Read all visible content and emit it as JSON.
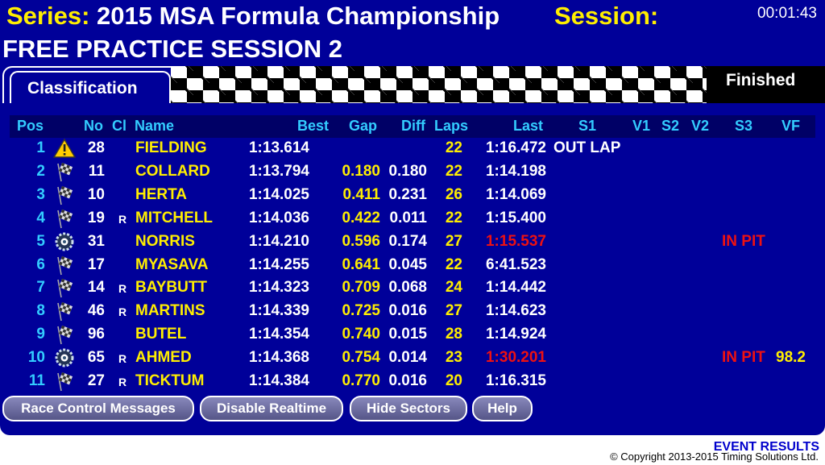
{
  "header": {
    "series_label": "Series:",
    "series_name": "2015 MSA Formula Championship",
    "session_label": "Session:",
    "session_name": "FREE PRACTICE SESSION 2",
    "clock": "00:01:43"
  },
  "tabs": {
    "classification": "Classification"
  },
  "status": "Finished",
  "columns": {
    "pos": "Pos",
    "no": "No",
    "cl": "Cl",
    "name": "Name",
    "best": "Best",
    "gap": "Gap",
    "diff": "Diff",
    "laps": "Laps",
    "last": "Last",
    "s1": "S1",
    "v1": "V1",
    "s2": "S2",
    "v2": "V2",
    "s3": "S3",
    "vf": "VF"
  },
  "rows": [
    {
      "pos": "1",
      "icon": "warning-icon",
      "no": "28",
      "cl": "",
      "name": "FIELDING",
      "best": "1:13.614",
      "gap": "",
      "diff": "",
      "laps": "22",
      "last": "1:16.472",
      "last_red": false,
      "s1": "OUT LAP",
      "s3": "",
      "vf": ""
    },
    {
      "pos": "2",
      "icon": "checkered-flag-icon",
      "no": "11",
      "cl": "",
      "name": "COLLARD",
      "best": "1:13.794",
      "gap": "0.180",
      "diff": "0.180",
      "laps": "22",
      "last": "1:14.198",
      "last_red": false,
      "s1": "",
      "s3": "",
      "vf": ""
    },
    {
      "pos": "3",
      "icon": "checkered-flag-icon",
      "no": "10",
      "cl": "",
      "name": "HERTA",
      "best": "1:14.025",
      "gap": "0.411",
      "diff": "0.231",
      "laps": "26",
      "last": "1:14.069",
      "last_red": false,
      "s1": "",
      "s3": "",
      "vf": ""
    },
    {
      "pos": "4",
      "icon": "checkered-flag-icon",
      "no": "19",
      "cl": "R",
      "name": "MITCHELL",
      "best": "1:14.036",
      "gap": "0.422",
      "diff": "0.011",
      "laps": "22",
      "last": "1:15.400",
      "last_red": false,
      "s1": "",
      "s3": "",
      "vf": ""
    },
    {
      "pos": "5",
      "icon": "pit-tyre-icon",
      "no": "31",
      "cl": "",
      "name": "NORRIS",
      "best": "1:14.210",
      "gap": "0.596",
      "diff": "0.174",
      "laps": "27",
      "last": "1:15.537",
      "last_red": true,
      "s1": "",
      "s3": "IN PIT",
      "vf": ""
    },
    {
      "pos": "6",
      "icon": "checkered-flag-icon",
      "no": "17",
      "cl": "",
      "name": "MYASAVA",
      "best": "1:14.255",
      "gap": "0.641",
      "diff": "0.045",
      "laps": "22",
      "last": "6:41.523",
      "last_red": false,
      "s1": "",
      "s3": "",
      "vf": ""
    },
    {
      "pos": "7",
      "icon": "checkered-flag-icon",
      "no": "14",
      "cl": "R",
      "name": "BAYBUTT",
      "best": "1:14.323",
      "gap": "0.709",
      "diff": "0.068",
      "laps": "24",
      "last": "1:14.442",
      "last_red": false,
      "s1": "",
      "s3": "",
      "vf": ""
    },
    {
      "pos": "8",
      "icon": "checkered-flag-icon",
      "no": "46",
      "cl": "R",
      "name": "MARTINS",
      "best": "1:14.339",
      "gap": "0.725",
      "diff": "0.016",
      "laps": "27",
      "last": "1:14.623",
      "last_red": false,
      "s1": "",
      "s3": "",
      "vf": ""
    },
    {
      "pos": "9",
      "icon": "checkered-flag-icon",
      "no": "96",
      "cl": "",
      "name": "BUTEL",
      "best": "1:14.354",
      "gap": "0.740",
      "diff": "0.015",
      "laps": "28",
      "last": "1:14.924",
      "last_red": false,
      "s1": "",
      "s3": "",
      "vf": ""
    },
    {
      "pos": "10",
      "icon": "pit-tyre-icon",
      "no": "65",
      "cl": "R",
      "name": "AHMED",
      "best": "1:14.368",
      "gap": "0.754",
      "diff": "0.014",
      "laps": "23",
      "last": "1:30.201",
      "last_red": true,
      "s1": "",
      "s3": "IN PIT",
      "vf": "98.2"
    },
    {
      "pos": "11",
      "icon": "checkered-flag-icon",
      "no": "27",
      "cl": "R",
      "name": "TICKTUM",
      "best": "1:14.384",
      "gap": "0.770",
      "diff": "0.016",
      "laps": "20",
      "last": "1:16.315",
      "last_red": false,
      "s1": "",
      "s3": "",
      "vf": ""
    }
  ],
  "buttons": {
    "race_control": "Race Control Messages",
    "disable_realtime": "Disable Realtime",
    "hide_sectors": "Hide Sectors",
    "help": "Help"
  },
  "footer": {
    "event_results": "EVENT RESULTS",
    "copyright": "© Copyright 2013-2015 Timing Solutions Ltd."
  },
  "colors": {
    "background": "#000099",
    "header_yellow": "#ffee00",
    "column_cyan": "#33ccff",
    "alert_red": "#ee1111"
  }
}
